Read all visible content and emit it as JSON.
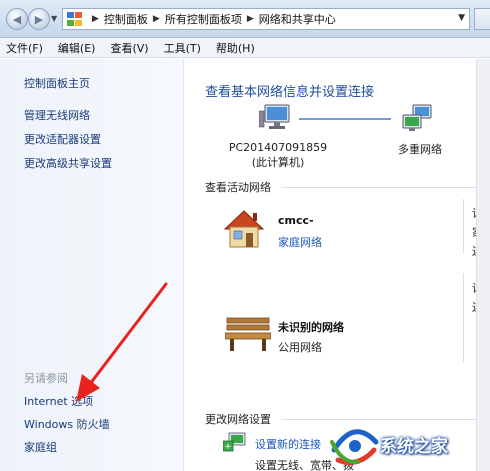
{
  "address_bar": {
    "breadcrumbs": [
      "控制面板",
      "所有控制面板项",
      "网络和共享中心"
    ]
  },
  "menu": [
    "文件(F)",
    "编辑(E)",
    "查看(V)",
    "工具(T)",
    "帮助(H)"
  ],
  "sidebar": {
    "home": "控制面板主页",
    "links": [
      "管理无线网络",
      "更改适配器设置",
      "更改高级共享设置"
    ],
    "see_also_heading": "另请参阅",
    "see_also": [
      "Internet 选项",
      "Windows 防火墙",
      "家庭组"
    ]
  },
  "main": {
    "title": "查看基本网络信息并设置连接",
    "map": {
      "computer_name": "PC201407091859",
      "computer_sub": "(此计算机)",
      "network": "多重网络"
    },
    "active_heading": "查看活动网络",
    "networks": [
      {
        "name": "cmcc-",
        "type": "家庭网络"
      },
      {
        "name": "未识别的网络",
        "type": "公用网络"
      }
    ],
    "right_col": [
      "访问",
      "家庭",
      "连接",
      "访问",
      "连接"
    ],
    "change_heading": "更改网络设置",
    "setup_link": "设置新的连接",
    "setup_desc": "设置无线、宽带、拨"
  },
  "watermark": {
    "text": "系统之家",
    "colors": {
      "blue": "#1d63c8",
      "red": "#e53b2c",
      "green": "#45a82f"
    }
  },
  "colors": {
    "link": "#1a3a7a",
    "title_blue": "#1e4f9c",
    "arrow": "#e8231d"
  }
}
